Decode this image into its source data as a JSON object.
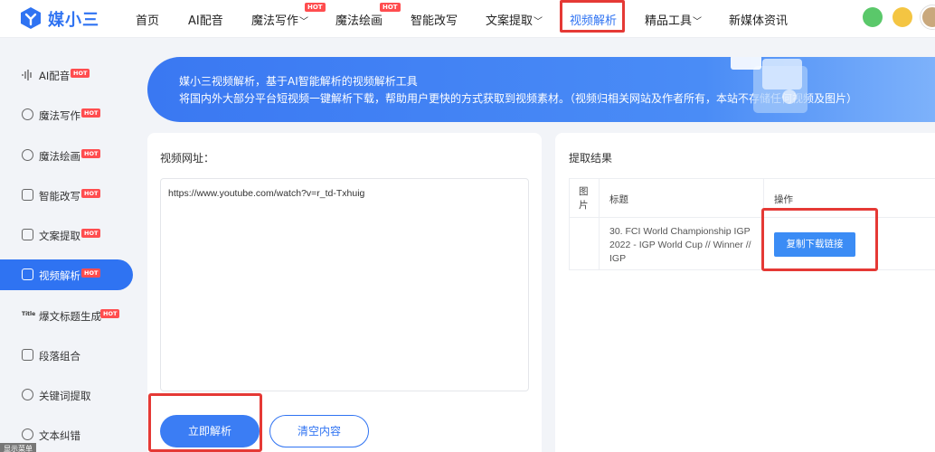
{
  "header": {
    "brand": "媒小三",
    "nav": [
      {
        "label": "首页"
      },
      {
        "label": "AI配音"
      },
      {
        "label": "魔法写作",
        "hot": "HOT"
      },
      {
        "label": "魔法绘画",
        "hot": "HOT"
      },
      {
        "label": "智能改写"
      },
      {
        "label": "文案提取"
      },
      {
        "label": "视频解析"
      },
      {
        "label": "精品工具"
      },
      {
        "label": "新媒体资讯"
      }
    ]
  },
  "sidebar": {
    "items": [
      {
        "label": "AI配音",
        "hot": "HOT"
      },
      {
        "label": "魔法写作",
        "hot": "HOT"
      },
      {
        "label": "魔法绘画",
        "hot": "HOT"
      },
      {
        "label": "智能改写",
        "hot": "HOT"
      },
      {
        "label": "文案提取",
        "hot": "HOT"
      },
      {
        "label": "视频解析",
        "hot": "HOT"
      },
      {
        "label": "爆文标题生成",
        "hot": "HOT"
      },
      {
        "label": "段落组合"
      },
      {
        "label": "关键词提取"
      },
      {
        "label": "文本纠错"
      }
    ],
    "menu_toggle": "显示菜单"
  },
  "banner": {
    "line1": "媒小三视频解析，基于AI智能解析的视频解析工具",
    "line2": "将国内外大部分平台短视频一键解析下载，帮助用户更快的方式获取到视频素材。（视频归相关网站及作者所有，本站不存储任何视频及图片）"
  },
  "input_panel": {
    "title": "视频网址：",
    "url_value": "https://www.youtube.com/watch?v=r_td-Txhuig",
    "parse_button": "立即解析",
    "clear_button": "清空内容"
  },
  "result_panel": {
    "title": "提取结果",
    "columns": [
      "图片",
      "标题",
      "操作"
    ],
    "rows": [
      {
        "title": "30. FCI World Championship IGP 2022 - IGP World Cup // Winner // IGP",
        "action": "复制下载链接"
      }
    ]
  },
  "colors": {
    "accent": "#2f73f2",
    "highlight": "#e53935",
    "hot": "#ff4d4f"
  }
}
